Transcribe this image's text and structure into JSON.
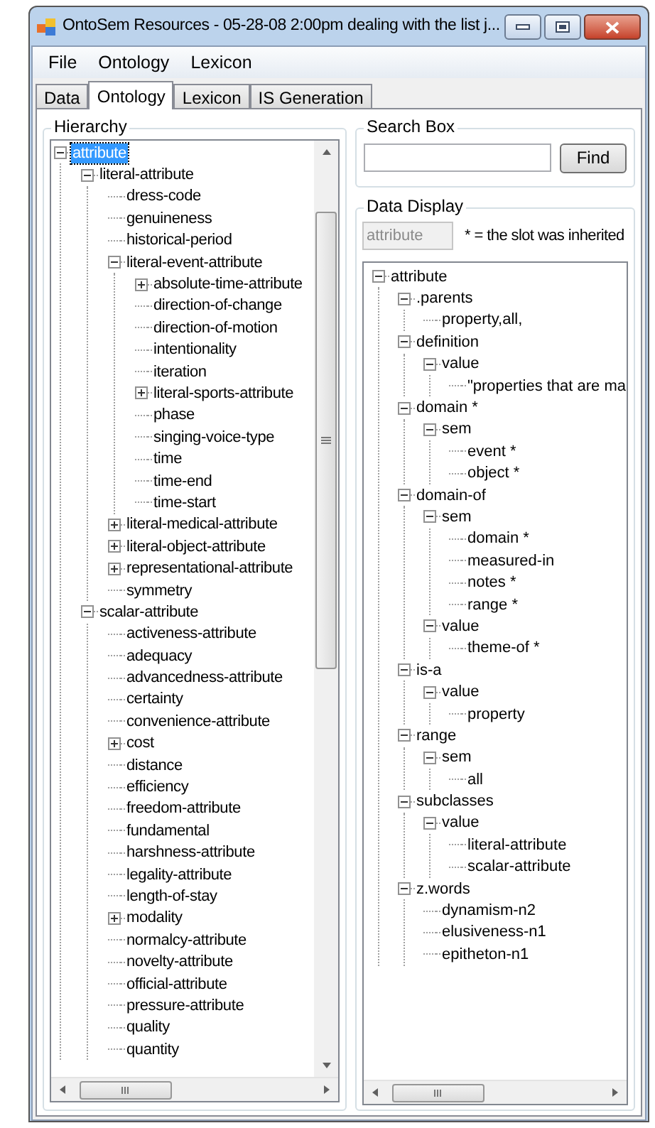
{
  "window": {
    "title": "OntoSem Resources - 05-28-08 2:00pm dealing with the list j..."
  },
  "menu": [
    "File",
    "Ontology",
    "Lexicon"
  ],
  "tabs": [
    {
      "label": "Data",
      "selected": false
    },
    {
      "label": "Ontology",
      "selected": true
    },
    {
      "label": "Lexicon",
      "selected": false
    },
    {
      "label": "IS Generation",
      "selected": false
    }
  ],
  "hierarchy": {
    "title": "Hierarchy",
    "nodes": [
      {
        "label": "attribute",
        "selected": true,
        "expanded": true,
        "children": [
          {
            "label": "literal-attribute",
            "selected": false,
            "expanded": true,
            "children": [
              {
                "label": "dress-code",
                "selected": false
              },
              {
                "label": "genuineness",
                "selected": false
              },
              {
                "label": "historical-period",
                "selected": false
              },
              {
                "label": "literal-event-attribute",
                "selected": false,
                "expanded": true,
                "children": [
                  {
                    "label": "absolute-time-attribute",
                    "selected": false,
                    "expanded": false
                  },
                  {
                    "label": "direction-of-change",
                    "selected": false
                  },
                  {
                    "label": "direction-of-motion",
                    "selected": false
                  },
                  {
                    "label": "intentionality",
                    "selected": false
                  },
                  {
                    "label": "iteration",
                    "selected": false
                  },
                  {
                    "label": "literal-sports-attribute",
                    "selected": false,
                    "expanded": false
                  },
                  {
                    "label": "phase",
                    "selected": false
                  },
                  {
                    "label": "singing-voice-type",
                    "selected": false
                  },
                  {
                    "label": "time",
                    "selected": false
                  },
                  {
                    "label": "time-end",
                    "selected": false
                  },
                  {
                    "label": "time-start",
                    "selected": false
                  }
                ]
              },
              {
                "label": "literal-medical-attribute",
                "selected": false,
                "expanded": false
              },
              {
                "label": "literal-object-attribute",
                "selected": false,
                "expanded": false
              },
              {
                "label": "representational-attribute",
                "selected": false,
                "expanded": false
              },
              {
                "label": "symmetry",
                "selected": false
              }
            ]
          },
          {
            "label": "scalar-attribute",
            "selected": false,
            "expanded": true,
            "children": [
              {
                "label": "activeness-attribute",
                "selected": false
              },
              {
                "label": "adequacy",
                "selected": false
              },
              {
                "label": "advancedness-attribute",
                "selected": false
              },
              {
                "label": "certainty",
                "selected": false
              },
              {
                "label": "convenience-attribute",
                "selected": false
              },
              {
                "label": "cost",
                "selected": false,
                "expanded": false
              },
              {
                "label": "distance",
                "selected": false
              },
              {
                "label": "efficiency",
                "selected": false
              },
              {
                "label": "freedom-attribute",
                "selected": false
              },
              {
                "label": "fundamental",
                "selected": false
              },
              {
                "label": "harshness-attribute",
                "selected": false
              },
              {
                "label": "legality-attribute",
                "selected": false
              },
              {
                "label": "length-of-stay",
                "selected": false
              },
              {
                "label": "modality",
                "selected": false,
                "expanded": false
              },
              {
                "label": "normalcy-attribute",
                "selected": false
              },
              {
                "label": "novelty-attribute",
                "selected": false
              },
              {
                "label": "official-attribute",
                "selected": false
              },
              {
                "label": "pressure-attribute",
                "selected": false
              },
              {
                "label": "quality",
                "selected": false
              },
              {
                "label": "quantity",
                "selected": false
              }
            ]
          }
        ]
      }
    ]
  },
  "search_box": {
    "title": "Search Box",
    "button": "Find"
  },
  "data_display": {
    "title": "Data Display",
    "concept": "attribute",
    "note": "* = the slot was inherited",
    "nodes": [
      {
        "label": "attribute",
        "expanded": true,
        "children": [
          {
            "label": ".parents",
            "expanded": true,
            "children": [
              {
                "label": "property,all,"
              }
            ]
          },
          {
            "label": "definition",
            "expanded": true,
            "children": [
              {
                "label": "value",
                "expanded": true,
                "children": [
                  {
                    "label": "\"properties that are ma"
                  }
                ]
              }
            ]
          },
          {
            "label": "domain *",
            "expanded": true,
            "children": [
              {
                "label": "sem",
                "expanded": true,
                "children": [
                  {
                    "label": "event *"
                  },
                  {
                    "label": "object *"
                  }
                ]
              }
            ]
          },
          {
            "label": "domain-of",
            "expanded": true,
            "children": [
              {
                "label": "sem",
                "expanded": true,
                "children": [
                  {
                    "label": "domain *"
                  },
                  {
                    "label": "measured-in"
                  },
                  {
                    "label": "notes *"
                  },
                  {
                    "label": "range *"
                  }
                ]
              },
              {
                "label": "value",
                "expanded": true,
                "children": [
                  {
                    "label": "theme-of *"
                  }
                ]
              }
            ]
          },
          {
            "label": "is-a",
            "expanded": true,
            "children": [
              {
                "label": "value",
                "expanded": true,
                "children": [
                  {
                    "label": "property"
                  }
                ]
              }
            ]
          },
          {
            "label": "range",
            "expanded": true,
            "children": [
              {
                "label": "sem",
                "expanded": true,
                "children": [
                  {
                    "label": "all"
                  }
                ]
              }
            ]
          },
          {
            "label": "subclasses",
            "expanded": true,
            "children": [
              {
                "label": "value",
                "expanded": true,
                "children": [
                  {
                    "label": "literal-attribute"
                  },
                  {
                    "label": "scalar-attribute"
                  }
                ]
              }
            ]
          },
          {
            "label": "z.words",
            "expanded": true,
            "children": [
              {
                "label": "dynamism-n2"
              },
              {
                "label": "elusiveness-n1"
              },
              {
                "label": "epitheton-n1"
              }
            ]
          }
        ]
      }
    ]
  }
}
